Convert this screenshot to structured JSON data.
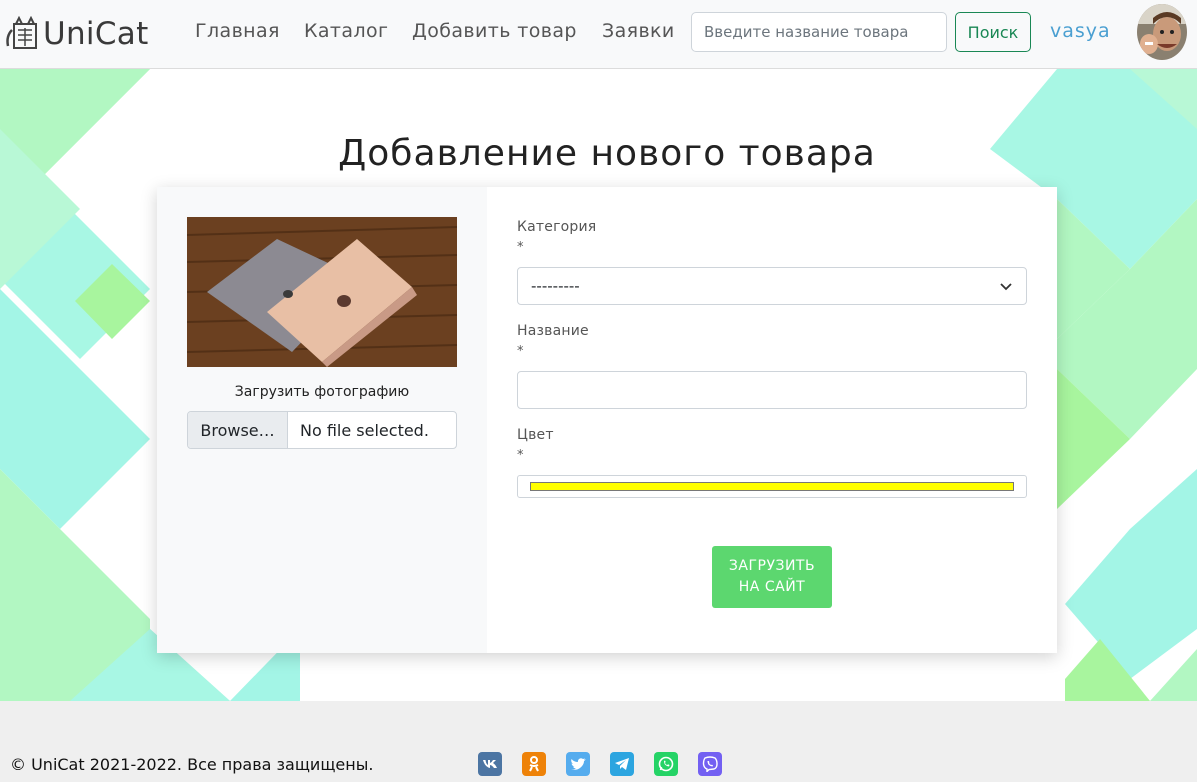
{
  "brand": {
    "name": "UniCat"
  },
  "nav": {
    "items": [
      {
        "label": "Главная"
      },
      {
        "label": "Каталог"
      },
      {
        "label": "Добавить товар"
      },
      {
        "label": "Заявки"
      }
    ],
    "search_placeholder": "Введите название товара",
    "search_button": "Поиск",
    "username": "vasya"
  },
  "page": {
    "title": "Добавление нового товара"
  },
  "form": {
    "upload_label": "Загрузить фотографию",
    "file_button": "Browse…",
    "file_status": "No file selected.",
    "category": {
      "label": "Категория",
      "required": "*",
      "value": "---------"
    },
    "name": {
      "label": "Название",
      "required": "*",
      "value": ""
    },
    "color": {
      "label": "Цвет",
      "required": "*",
      "value": "#ffff00"
    },
    "submit": "ЗАГРУЗИТЬ НА САЙТ"
  },
  "footer": {
    "copyright": "© UniCat 2021-2022. Все права защищены.",
    "social": [
      {
        "icon": "vk-icon",
        "color": "#4c75a3"
      },
      {
        "icon": "odnoklassniki-icon",
        "color": "#ee8208"
      },
      {
        "icon": "twitter-icon",
        "color": "#55acee"
      },
      {
        "icon": "telegram-icon",
        "color": "#2ca5e0"
      },
      {
        "icon": "whatsapp-icon",
        "color": "#25d366"
      },
      {
        "icon": "viber-icon",
        "color": "#7360f2"
      }
    ]
  },
  "colors": {
    "accent_green": "#198754",
    "submit_green": "#5cd76f",
    "user_blue": "#4a9fd1",
    "bg_mint": "#a8f7e4",
    "bg_lime": "#a8f59e"
  }
}
